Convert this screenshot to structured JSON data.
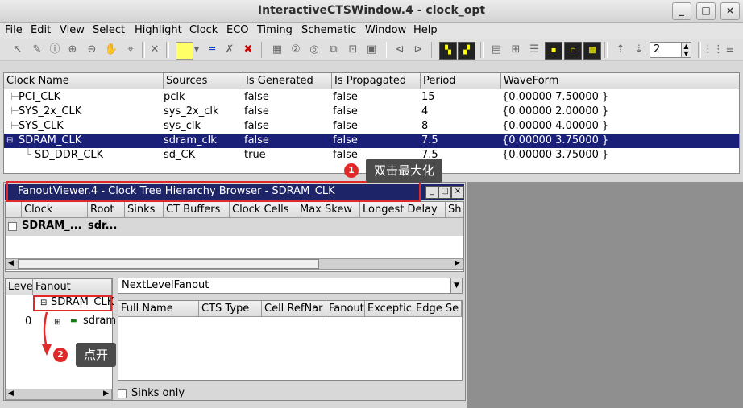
{
  "window": {
    "title": "InteractiveCTSWindow.4 - clock_opt",
    "controls": [
      "_",
      "□",
      "×"
    ]
  },
  "menubar": [
    "File",
    "Edit",
    "View",
    "Select",
    "Highlight",
    "Clock",
    "ECO",
    "Timing",
    "Schematic",
    "Window",
    "Help"
  ],
  "toolbar": {
    "zoom_value": "2"
  },
  "clock_table": {
    "headers": [
      "Clock Name",
      "Sources",
      "Is Generated",
      "Is Propagated",
      "Period",
      "WaveForm"
    ],
    "rows": [
      {
        "name": "PCI_CLK",
        "source": "pclk",
        "generated": "false",
        "propagated": "false",
        "period": "15",
        "waveform": "{0.00000 7.50000 }"
      },
      {
        "name": "SYS_2x_CLK",
        "source": "sys_2x_clk",
        "generated": "false",
        "propagated": "false",
        "period": "4",
        "waveform": "{0.00000 2.00000 }"
      },
      {
        "name": "SYS_CLK",
        "source": "sys_clk",
        "generated": "false",
        "propagated": "false",
        "period": "8",
        "waveform": "{0.00000 4.00000 }"
      },
      {
        "name": "SDRAM_CLK",
        "source": "sdram_clk",
        "generated": "false",
        "propagated": "false",
        "period": "7.5",
        "waveform": "{0.00000 3.75000 }"
      },
      {
        "name": "SD_DDR_CLK",
        "source": "sd_CK",
        "generated": "true",
        "propagated": "false",
        "period": "7.5",
        "waveform": "{0.00000 3.75000 }"
      }
    ]
  },
  "fanout_viewer": {
    "title": "FanoutViewer.4 - Clock Tree Hierarchy Browser - SDRAM_CLK",
    "summary_headers": [
      "Clock",
      "Root",
      "Sinks",
      "CT Buffers",
      "Clock Cells",
      "Max Skew",
      "Longest Delay",
      "Sh"
    ],
    "summary_row": {
      "clock": "SDRAM_...",
      "root": "sdr..."
    },
    "tree_headers": [
      "Leve",
      "Fanout"
    ],
    "tree_root": "SDRAM_CLK",
    "tree_child": {
      "level": "0",
      "name": "sdram"
    },
    "dropdown_value": "NextLevelFanout",
    "detail_headers": [
      "Full Name",
      "CTS Type",
      "Cell RefNar",
      "Fanout",
      "Exceptic",
      "Edge Se"
    ],
    "sinks_only_label": "Sinks only"
  },
  "annotations": [
    {
      "number": "1",
      "text": "双击最大化"
    },
    {
      "number": "2",
      "text": "点开"
    }
  ],
  "colors": {
    "selection": "#1a1f78",
    "callout_red": "#e02a2a",
    "callout_bg": "#4b4b4b"
  }
}
